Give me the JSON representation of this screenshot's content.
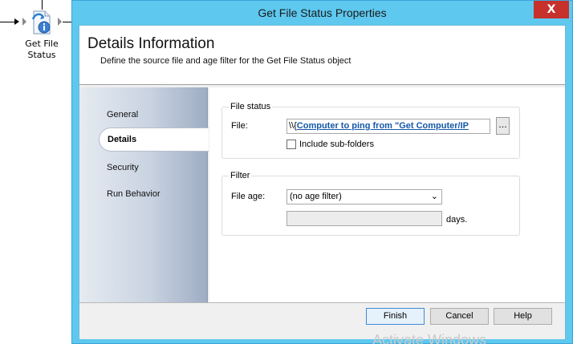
{
  "canvas": {
    "activity_label_line1": "Get File",
    "activity_label_line2": "Status",
    "activity_icon": "file-info-icon"
  },
  "dialog": {
    "title": "Get File Status Properties",
    "close_glyph": "X"
  },
  "header": {
    "title": "Details Information",
    "description": "Define the source file and age filter for the Get File Status object"
  },
  "nav": {
    "items": [
      {
        "label": "General"
      },
      {
        "label": "Details",
        "selected": true
      },
      {
        "label": "Security"
      },
      {
        "label": "Run Behavior"
      }
    ]
  },
  "file_status": {
    "group_title": "File status",
    "file_label": "File:",
    "file_prefix": "\\\\{",
    "file_link": "Computer to ping from \"Get Computer/IP",
    "browse_label": "...",
    "include_subfolders_label": "Include sub-folders",
    "include_subfolders_checked": false
  },
  "filter": {
    "group_title": "Filter",
    "file_age_label": "File age:",
    "file_age_value": "(no age filter)",
    "days_value": "",
    "days_label": "days."
  },
  "footer": {
    "finish_label": "Finish",
    "cancel_label": "Cancel",
    "help_label": "Help",
    "watermark": "Activate Windows"
  },
  "colors": {
    "titlebar": "#5ec8ef",
    "close_button": "#c7312b",
    "link": "#1558a8"
  }
}
